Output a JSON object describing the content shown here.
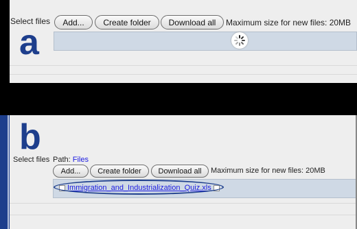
{
  "panel_a": {
    "letter": "a",
    "select_label": "Select files",
    "buttons": {
      "add": "Add...",
      "create_folder": "Create folder",
      "download_all": "Download all"
    },
    "max_size": "Maximum size for new files: 20MB"
  },
  "panel_b": {
    "letter": "b",
    "select_label": "Select files",
    "path_label": "Path:",
    "path_link": "Files",
    "buttons": {
      "add": "Add...",
      "create_folder": "Create folder",
      "download_all": "Download all"
    },
    "max_size": "Maximum size for new files: 20MB",
    "file_name": "Immigration_and_Industrialization_Quiz.xls"
  },
  "colors": {
    "accent": "#1d3e8c",
    "dropzone": "#cfd9e5",
    "link": "#1a1ae0"
  },
  "icons": [
    "loading-spinner-icon",
    "checkbox-icon",
    "file-icon"
  ]
}
